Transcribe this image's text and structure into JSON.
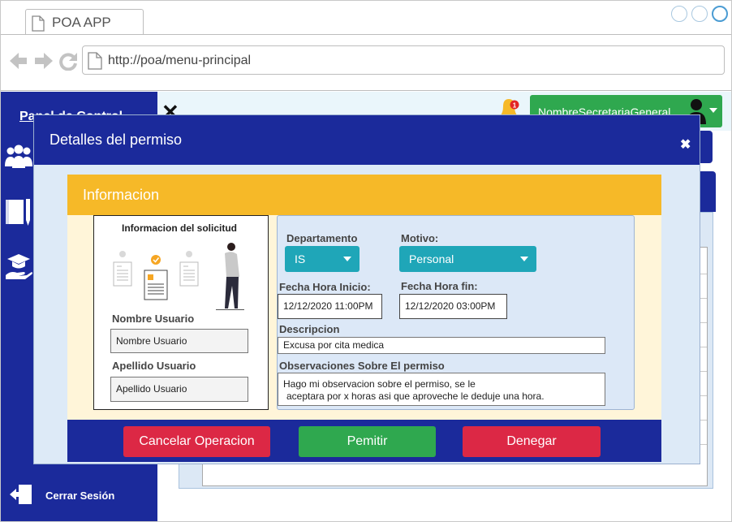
{
  "browser": {
    "tab_title": "POA APP",
    "url": "http://poa/menu-principal"
  },
  "header": {
    "user_name": "NombreSecretariaGeneral",
    "notification_count": "1"
  },
  "sidebar": {
    "title": "Panel de Control",
    "logout_label": "Cerrar Sesión"
  },
  "modal": {
    "title": "Detalles del permiso",
    "section_title": "Informacion",
    "requester_title": "Informacion del solicitud",
    "first_name_label": "Nombre Usuario",
    "first_name_value": "Nombre Usuario",
    "last_name_label": "Apellido Usuario",
    "last_name_value": "Apellido Usuario",
    "department_label": "Departamento",
    "department_value": "IS",
    "reason_label": "Motivo:",
    "reason_value": "Personal",
    "start_label": "Fecha Hora Inicio:",
    "start_value": "12/12/2020 11:00PM",
    "end_label": "Fecha Hora fin:",
    "end_value": "12/12/2020 03:00PM",
    "description_label": "Descripcion",
    "description_value": "Excusa por cita medica",
    "observations_label": "Observaciones Sobre El permiso",
    "observations_line1": "Hago mi observacion sobre el permiso, se le",
    "observations_line2": "aceptara por x horas asi que aproveche le deduje una hora.",
    "cancel_label": "Cancelar Operacion",
    "permit_label": "Pemitir",
    "deny_label": "Denegar"
  },
  "colors": {
    "primary": "#1b2a9b",
    "accent": "#f6b928",
    "success": "#2fa84f",
    "danger": "#dc2845",
    "select": "#1fa6b8"
  }
}
